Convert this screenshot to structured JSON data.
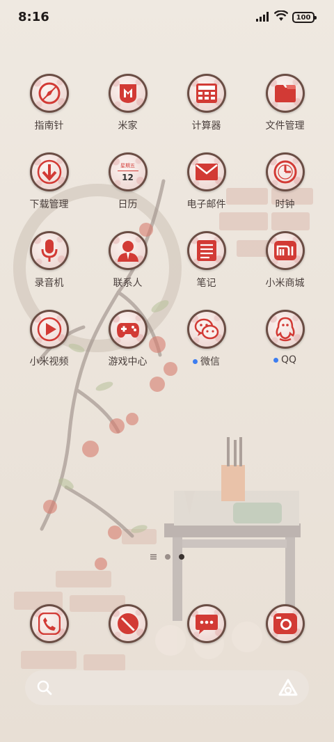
{
  "status_bar": {
    "time": "8:16",
    "battery": "100"
  },
  "apps": [
    {
      "id": "compass",
      "label": "指南针",
      "icon": "compass-icon"
    },
    {
      "id": "mijia",
      "label": "米家",
      "icon": "mijia-icon"
    },
    {
      "id": "calculator",
      "label": "计算器",
      "icon": "calculator-icon"
    },
    {
      "id": "file-manager",
      "label": "文件管理",
      "icon": "folder-icon"
    },
    {
      "id": "download-manager",
      "label": "下载管理",
      "icon": "download-icon"
    },
    {
      "id": "calendar",
      "label": "日历",
      "icon": "calendar-icon",
      "weekday": "星期五",
      "day": "12"
    },
    {
      "id": "email",
      "label": "电子邮件",
      "icon": "mail-icon"
    },
    {
      "id": "clock",
      "label": "时钟",
      "icon": "clock-icon"
    },
    {
      "id": "recorder",
      "label": "录音机",
      "icon": "microphone-icon"
    },
    {
      "id": "contacts",
      "label": "联系人",
      "icon": "person-icon"
    },
    {
      "id": "notes",
      "label": "笔记",
      "icon": "notes-icon"
    },
    {
      "id": "mi-store",
      "label": "小米商城",
      "icon": "mi-logo-icon"
    },
    {
      "id": "mi-video",
      "label": "小米视频",
      "icon": "play-icon"
    },
    {
      "id": "game-center",
      "label": "游戏中心",
      "icon": "gamepad-icon"
    },
    {
      "id": "wechat",
      "label": "微信",
      "icon": "wechat-icon",
      "badge": true
    },
    {
      "id": "qq",
      "label": "QQ",
      "icon": "qq-icon",
      "badge": true
    }
  ],
  "dock": [
    {
      "id": "phone",
      "icon": "phone-icon"
    },
    {
      "id": "browser",
      "icon": "browser-icon"
    },
    {
      "id": "messages",
      "icon": "message-icon"
    },
    {
      "id": "camera",
      "icon": "camera-icon"
    }
  ],
  "pager": {
    "total": 2,
    "active": 2
  },
  "search": {
    "placeholder": ""
  },
  "colors": {
    "accent": "#d23a35",
    "ring": "#6a4d44",
    "badge": "#3d7df0"
  }
}
